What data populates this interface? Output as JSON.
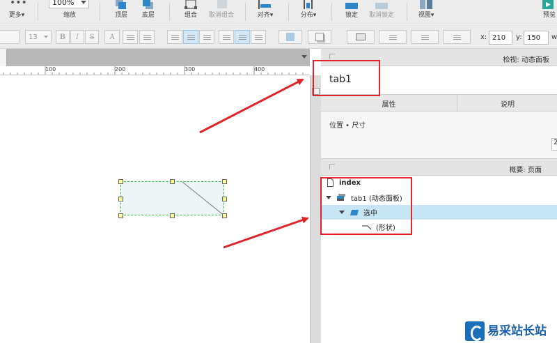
{
  "toolbar": {
    "more_label": "更多▾",
    "zoom_value": "100%",
    "zoom_label": "缩放",
    "top_label": "顶层",
    "bottom_label": "底层",
    "group_label": "组合",
    "ungroup_label": "取消组合",
    "align_label": "对齐▾",
    "distribute_label": "分布▾",
    "lock_label": "锁定",
    "unlock_label": "取消锁定",
    "view_label": "视图▾",
    "preview_label": "预览"
  },
  "formatbar": {
    "font_size": "13",
    "bold": "B",
    "italic": "I",
    "underline": "S",
    "x_label": "x:",
    "x_value": "210",
    "y_label": "y:",
    "y_value": "150",
    "w_label": "w"
  },
  "ruler": {
    "marks": [
      "100",
      "200",
      "300",
      "400"
    ]
  },
  "inspector": {
    "title": "检视: 动态面板",
    "name_value": "tab1",
    "tabs": [
      "属性",
      "说明"
    ],
    "section_label": "位置 • 尺寸",
    "size_value_partial": "2"
  },
  "outline": {
    "title": "概要: 页面",
    "items": [
      {
        "label": "index"
      },
      {
        "label": "tab1 (动态面板)"
      },
      {
        "label": "选中"
      },
      {
        "label": "(形状)"
      }
    ]
  },
  "colors": {
    "highlight": "#c7e6f5",
    "annotation_red": "#e0242a",
    "selection_green": "#35c035"
  },
  "watermark": {
    "text": "易采站长站"
  }
}
